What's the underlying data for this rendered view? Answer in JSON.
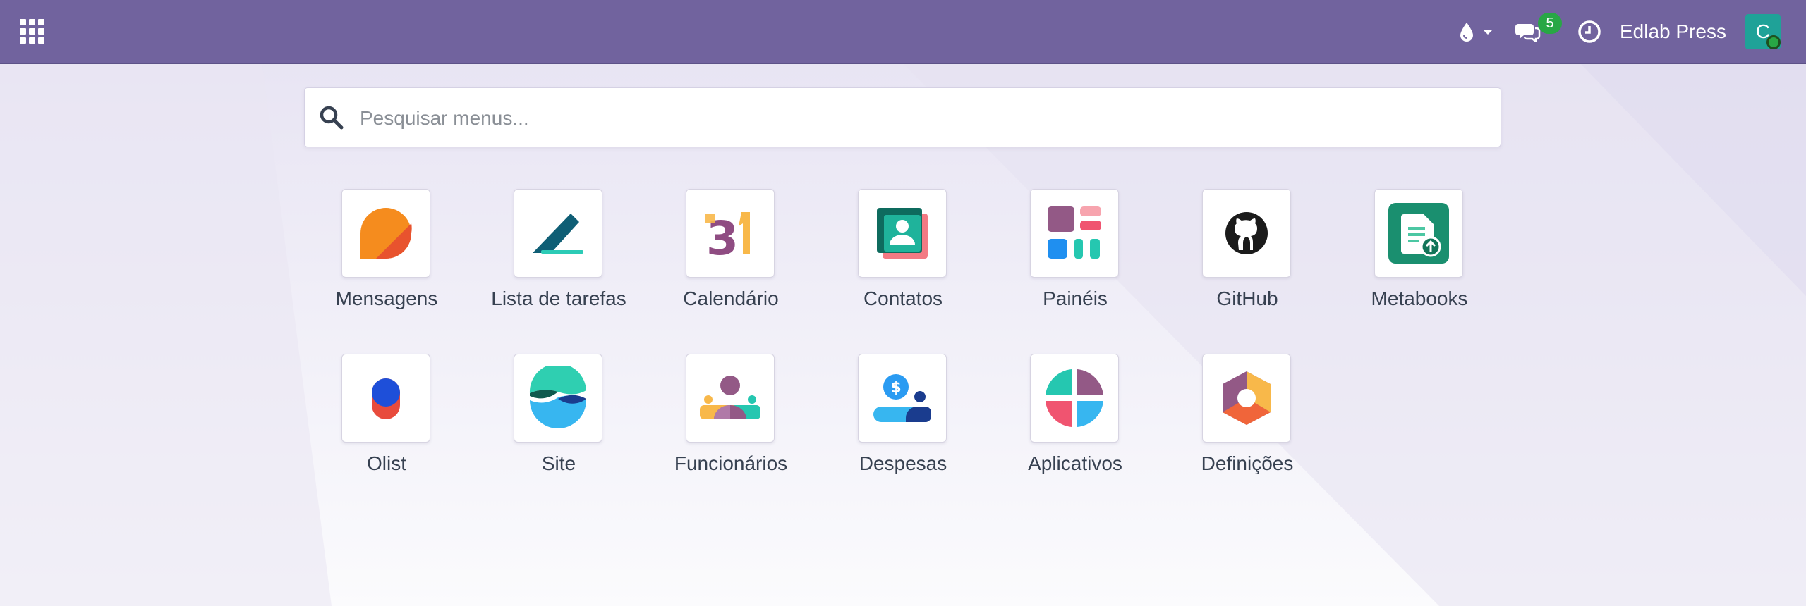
{
  "navbar": {
    "apps_menu_icon": "grid-icon",
    "theme_icon": "droplet-icon",
    "messages_icon": "chat-icon",
    "messages_count": "5",
    "activities_icon": "clock-icon",
    "company_name": "Edlab Press",
    "user_initial": "C",
    "brand_color": "#71639e"
  },
  "search": {
    "placeholder": "Pesquisar menus..."
  },
  "apps": [
    {
      "label": "Mensagens",
      "icon": "discuss-icon"
    },
    {
      "label": "Lista de tarefas",
      "icon": "todo-icon"
    },
    {
      "label": "Calendário",
      "icon": "calendar-icon"
    },
    {
      "label": "Contatos",
      "icon": "contacts-icon"
    },
    {
      "label": "Painéis",
      "icon": "dashboards-icon"
    },
    {
      "label": "GitHub",
      "icon": "github-icon"
    },
    {
      "label": "Metabooks",
      "icon": "metabooks-icon"
    },
    {
      "label": "Olist",
      "icon": "olist-icon"
    },
    {
      "label": "Site",
      "icon": "website-icon"
    },
    {
      "label": "Funcionários",
      "icon": "employees-icon"
    },
    {
      "label": "Despesas",
      "icon": "expenses-icon"
    },
    {
      "label": "Aplicativos",
      "icon": "apps-icon"
    },
    {
      "label": "Definições",
      "icon": "settings-icon"
    }
  ]
}
